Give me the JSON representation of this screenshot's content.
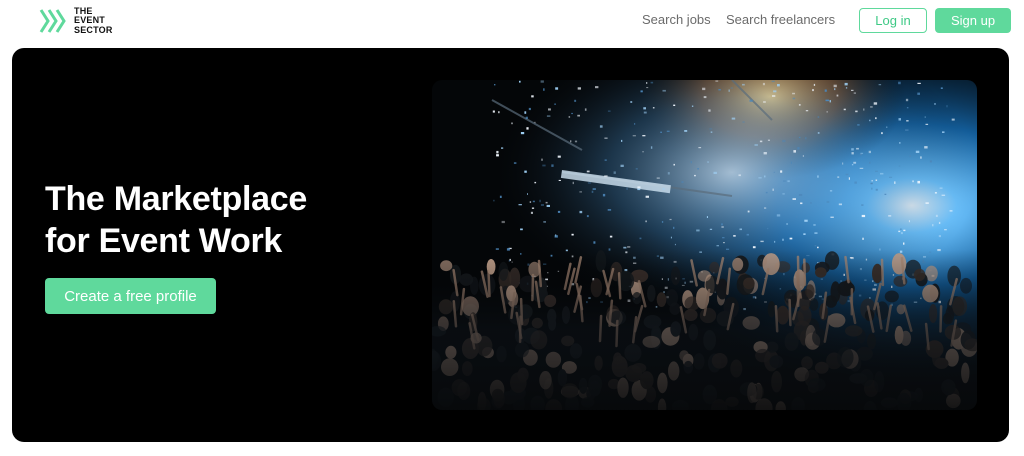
{
  "brand": {
    "line1": "THE",
    "line2": "EVENT",
    "line3": "SECTOR",
    "accent": "#5fd99c"
  },
  "nav": {
    "search_jobs": "Search jobs",
    "search_freelancers": "Search freelancers",
    "login": "Log in",
    "signup": "Sign up"
  },
  "hero": {
    "title_line1": "The Marketplace",
    "title_line2": "for Event Work",
    "cta": "Create a free profile",
    "image_subject": "concert-crowd-confetti-photo"
  }
}
